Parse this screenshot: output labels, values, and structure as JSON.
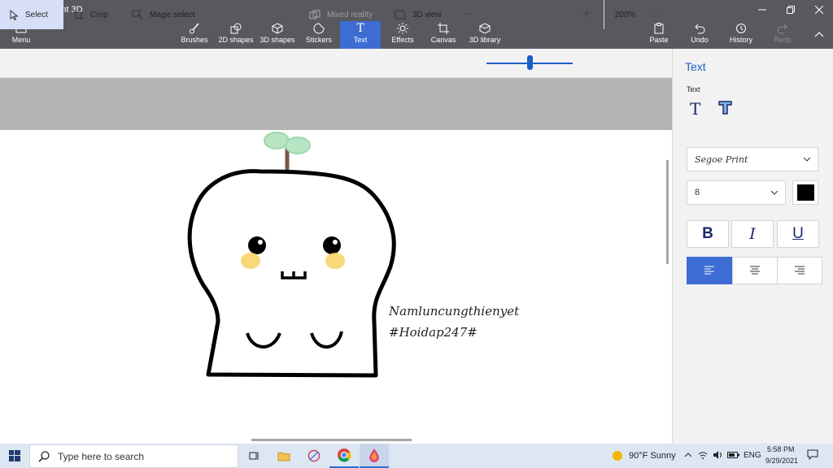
{
  "window": {
    "title": "Untitled* - Paint 3D"
  },
  "ribbon": {
    "menu": "Menu",
    "brushes": "Brushes",
    "shapes2d": "2D shapes",
    "shapes3d": "3D shapes",
    "stickers": "Stickers",
    "text": "Text",
    "effects": "Effects",
    "canvas": "Canvas",
    "library3d": "3D library",
    "paste": "Paste",
    "undo": "Undo",
    "history": "History",
    "redo": "Redo"
  },
  "toolbar": {
    "select": "Select",
    "crop": "Crop",
    "magic_select": "Magic select",
    "mixed_reality": "Mixed reality",
    "view3d": "3D view",
    "zoom": "200%",
    "zoom_level": 0.5
  },
  "drawing": {
    "line1": "Namluncungthienyet",
    "line2": "#Hoidap247#"
  },
  "panel": {
    "title": "Text",
    "subtitle": "Text",
    "font": "Segoe Print",
    "size": "8",
    "bold": "B",
    "italic": "I",
    "underline": "U",
    "text_color": "#000000",
    "accent": "#3d6cd3"
  },
  "taskbar": {
    "search_placeholder": "Type here to search",
    "weather": "90°F  Sunny",
    "language": "ENG",
    "time": "5:58 PM",
    "date": "9/29/2021"
  }
}
